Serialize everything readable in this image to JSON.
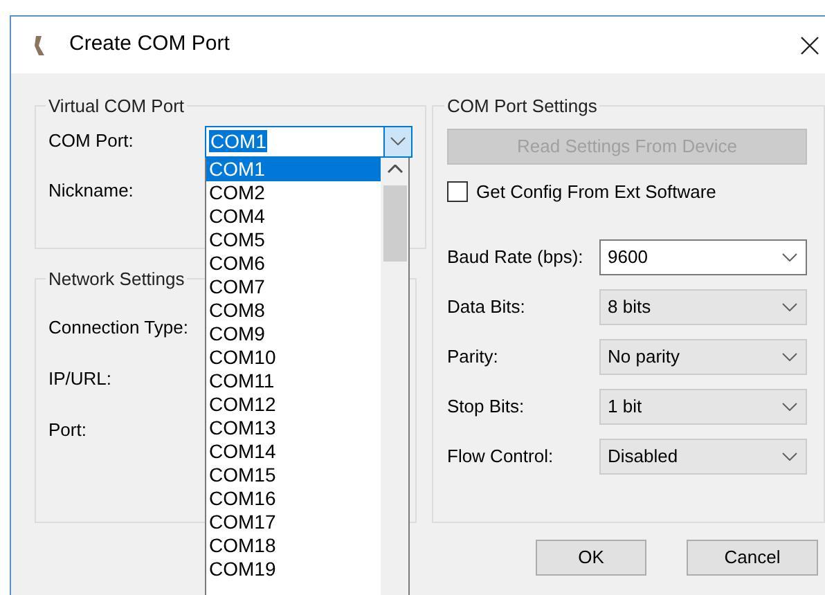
{
  "window": {
    "title": "Create COM Port"
  },
  "virtual_com_port": {
    "title": "Virtual COM Port",
    "com_port": {
      "label": "COM Port:",
      "value": "COM1",
      "expanded": true,
      "items": [
        {
          "label": "COM1",
          "selected": true
        },
        {
          "label": "COM2",
          "selected": false
        },
        {
          "label": "COM4",
          "selected": false
        },
        {
          "label": "COM5",
          "selected": false
        },
        {
          "label": "COM6",
          "selected": false
        },
        {
          "label": "COM7",
          "selected": false
        },
        {
          "label": "COM8",
          "selected": false
        },
        {
          "label": "COM9",
          "selected": false
        },
        {
          "label": "COM10",
          "selected": false
        },
        {
          "label": "COM11",
          "selected": false
        },
        {
          "label": "COM12",
          "selected": false
        },
        {
          "label": "COM13",
          "selected": false
        },
        {
          "label": "COM14",
          "selected": false
        },
        {
          "label": "COM15",
          "selected": false
        },
        {
          "label": "COM16",
          "selected": false
        },
        {
          "label": "COM17",
          "selected": false
        },
        {
          "label": "COM18",
          "selected": false
        },
        {
          "label": "COM19",
          "selected": false
        }
      ]
    },
    "nickname_label": "Nickname:"
  },
  "network_settings": {
    "title": "Network Settings",
    "labels": [
      "Connection Type:",
      "IP/URL:",
      "Port:"
    ]
  },
  "com_port_settings": {
    "title": "COM Port Settings",
    "read_button": {
      "label": "Read Settings From Device",
      "disabled": true
    },
    "checkbox": {
      "label": "Get Config From Ext Software",
      "checked": false
    },
    "fields": [
      {
        "label": "Baud Rate (bps):",
        "value": "9600",
        "editable": true
      },
      {
        "label": "Data Bits:",
        "value": "8 bits",
        "editable": false
      },
      {
        "label": "Parity:",
        "value": "No parity",
        "editable": false
      },
      {
        "label": "Stop Bits:",
        "value": "1 bit",
        "editable": false
      },
      {
        "label": "Flow Control:",
        "value": "Disabled",
        "editable": false
      }
    ]
  },
  "buttons": [
    "OK",
    "Cancel"
  ]
}
